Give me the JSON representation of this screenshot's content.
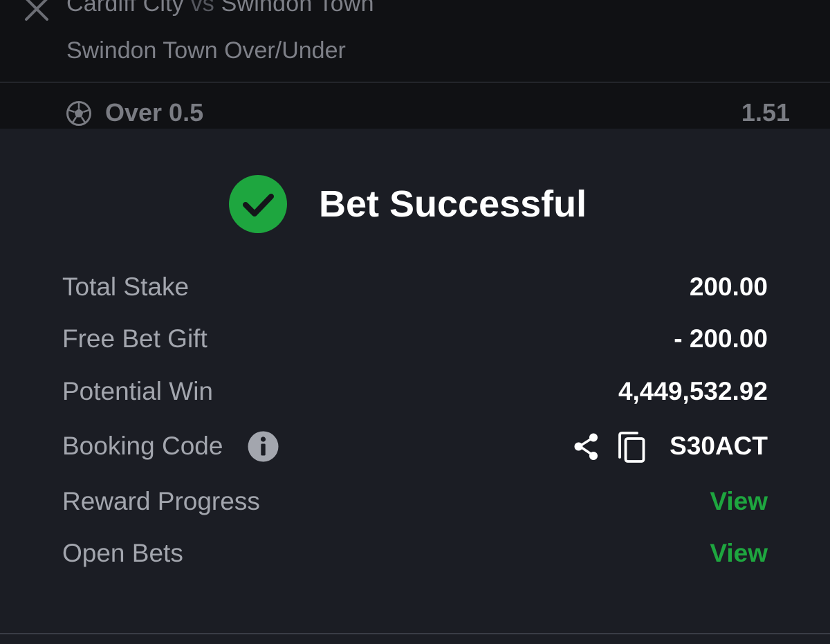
{
  "bet_slip": {
    "home_team": "Cardiff City",
    "vs": "vs",
    "away_team": "Swindon Town",
    "market": "Swindon Town Over/Under",
    "selection": "Over 0.5",
    "odds": "1.51"
  },
  "modal": {
    "title": "Bet Successful",
    "rows": {
      "total_stake": {
        "label": "Total Stake",
        "value": "200.00"
      },
      "free_bet_gift": {
        "label": "Free Bet Gift",
        "value": "- 200.00"
      },
      "potential_win": {
        "label": "Potential Win",
        "value": "4,449,532.92"
      },
      "booking_code": {
        "label": "Booking Code",
        "value": "S30ACT"
      },
      "reward_progress": {
        "label": "Reward Progress",
        "value": "View"
      },
      "open_bets": {
        "label": "Open Bets",
        "value": "View"
      }
    }
  },
  "icons": {
    "close": "close-icon",
    "ball": "soccer-ball-icon",
    "check": "check-circle-icon",
    "info": "info-icon",
    "share": "share-icon",
    "copy": "copy-icon"
  },
  "colors": {
    "success_green": "#1ea63f",
    "modal_bg": "#1b1d24",
    "label_gray": "#a3a6ae"
  }
}
